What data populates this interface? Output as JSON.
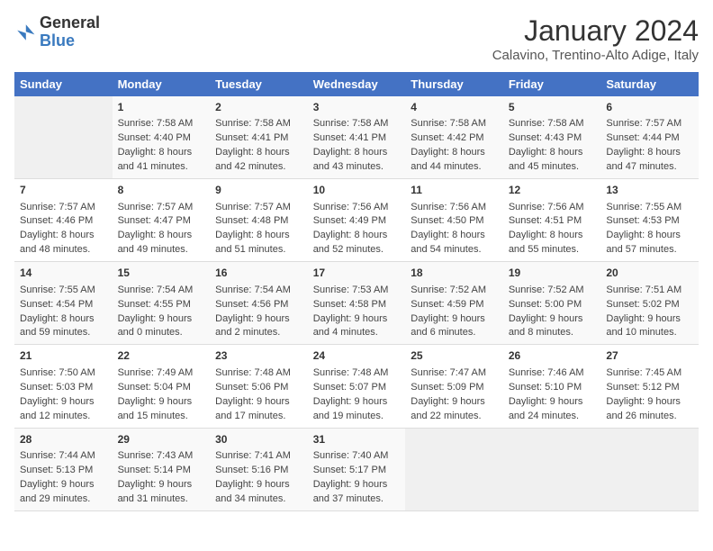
{
  "logo": {
    "general": "General",
    "blue": "Blue"
  },
  "header": {
    "month": "January 2024",
    "location": "Calavino, Trentino-Alto Adige, Italy"
  },
  "days_of_week": [
    "Sunday",
    "Monday",
    "Tuesday",
    "Wednesday",
    "Thursday",
    "Friday",
    "Saturday"
  ],
  "weeks": [
    [
      {
        "day": "",
        "empty": true
      },
      {
        "day": "1",
        "sunrise": "7:58 AM",
        "sunset": "4:40 PM",
        "daylight": "8 hours and 41 minutes."
      },
      {
        "day": "2",
        "sunrise": "7:58 AM",
        "sunset": "4:41 PM",
        "daylight": "8 hours and 42 minutes."
      },
      {
        "day": "3",
        "sunrise": "7:58 AM",
        "sunset": "4:41 PM",
        "daylight": "8 hours and 43 minutes."
      },
      {
        "day": "4",
        "sunrise": "7:58 AM",
        "sunset": "4:42 PM",
        "daylight": "8 hours and 44 minutes."
      },
      {
        "day": "5",
        "sunrise": "7:58 AM",
        "sunset": "4:43 PM",
        "daylight": "8 hours and 45 minutes."
      },
      {
        "day": "6",
        "sunrise": "7:57 AM",
        "sunset": "4:44 PM",
        "daylight": "8 hours and 47 minutes."
      }
    ],
    [
      {
        "day": "7",
        "sunrise": "7:57 AM",
        "sunset": "4:46 PM",
        "daylight": "8 hours and 48 minutes."
      },
      {
        "day": "8",
        "sunrise": "7:57 AM",
        "sunset": "4:47 PM",
        "daylight": "8 hours and 49 minutes."
      },
      {
        "day": "9",
        "sunrise": "7:57 AM",
        "sunset": "4:48 PM",
        "daylight": "8 hours and 51 minutes."
      },
      {
        "day": "10",
        "sunrise": "7:56 AM",
        "sunset": "4:49 PM",
        "daylight": "8 hours and 52 minutes."
      },
      {
        "day": "11",
        "sunrise": "7:56 AM",
        "sunset": "4:50 PM",
        "daylight": "8 hours and 54 minutes."
      },
      {
        "day": "12",
        "sunrise": "7:56 AM",
        "sunset": "4:51 PM",
        "daylight": "8 hours and 55 minutes."
      },
      {
        "day": "13",
        "sunrise": "7:55 AM",
        "sunset": "4:53 PM",
        "daylight": "8 hours and 57 minutes."
      }
    ],
    [
      {
        "day": "14",
        "sunrise": "7:55 AM",
        "sunset": "4:54 PM",
        "daylight": "8 hours and 59 minutes."
      },
      {
        "day": "15",
        "sunrise": "7:54 AM",
        "sunset": "4:55 PM",
        "daylight": "9 hours and 0 minutes."
      },
      {
        "day": "16",
        "sunrise": "7:54 AM",
        "sunset": "4:56 PM",
        "daylight": "9 hours and 2 minutes."
      },
      {
        "day": "17",
        "sunrise": "7:53 AM",
        "sunset": "4:58 PM",
        "daylight": "9 hours and 4 minutes."
      },
      {
        "day": "18",
        "sunrise": "7:52 AM",
        "sunset": "4:59 PM",
        "daylight": "9 hours and 6 minutes."
      },
      {
        "day": "19",
        "sunrise": "7:52 AM",
        "sunset": "5:00 PM",
        "daylight": "9 hours and 8 minutes."
      },
      {
        "day": "20",
        "sunrise": "7:51 AM",
        "sunset": "5:02 PM",
        "daylight": "9 hours and 10 minutes."
      }
    ],
    [
      {
        "day": "21",
        "sunrise": "7:50 AM",
        "sunset": "5:03 PM",
        "daylight": "9 hours and 12 minutes."
      },
      {
        "day": "22",
        "sunrise": "7:49 AM",
        "sunset": "5:04 PM",
        "daylight": "9 hours and 15 minutes."
      },
      {
        "day": "23",
        "sunrise": "7:48 AM",
        "sunset": "5:06 PM",
        "daylight": "9 hours and 17 minutes."
      },
      {
        "day": "24",
        "sunrise": "7:48 AM",
        "sunset": "5:07 PM",
        "daylight": "9 hours and 19 minutes."
      },
      {
        "day": "25",
        "sunrise": "7:47 AM",
        "sunset": "5:09 PM",
        "daylight": "9 hours and 22 minutes."
      },
      {
        "day": "26",
        "sunrise": "7:46 AM",
        "sunset": "5:10 PM",
        "daylight": "9 hours and 24 minutes."
      },
      {
        "day": "27",
        "sunrise": "7:45 AM",
        "sunset": "5:12 PM",
        "daylight": "9 hours and 26 minutes."
      }
    ],
    [
      {
        "day": "28",
        "sunrise": "7:44 AM",
        "sunset": "5:13 PM",
        "daylight": "9 hours and 29 minutes."
      },
      {
        "day": "29",
        "sunrise": "7:43 AM",
        "sunset": "5:14 PM",
        "daylight": "9 hours and 31 minutes."
      },
      {
        "day": "30",
        "sunrise": "7:41 AM",
        "sunset": "5:16 PM",
        "daylight": "9 hours and 34 minutes."
      },
      {
        "day": "31",
        "sunrise": "7:40 AM",
        "sunset": "5:17 PM",
        "daylight": "9 hours and 37 minutes."
      },
      {
        "day": "",
        "empty": true
      },
      {
        "day": "",
        "empty": true
      },
      {
        "day": "",
        "empty": true
      }
    ]
  ],
  "labels": {
    "sunrise": "Sunrise:",
    "sunset": "Sunset:",
    "daylight": "Daylight:"
  }
}
